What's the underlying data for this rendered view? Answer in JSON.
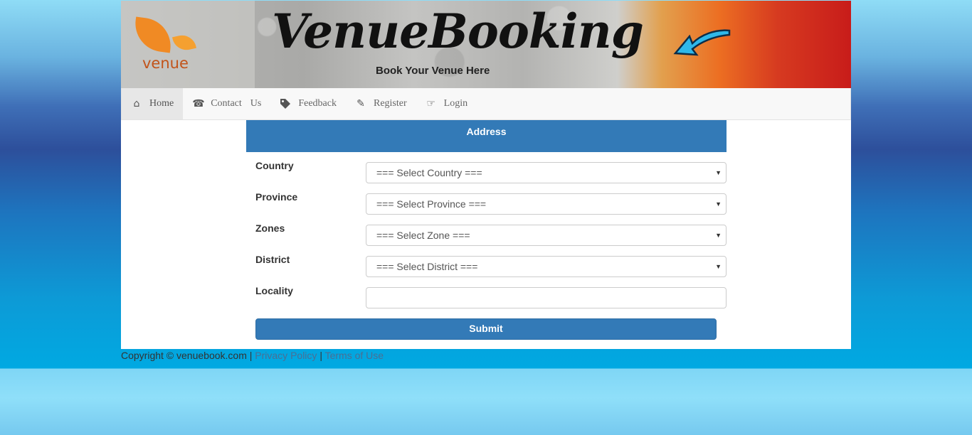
{
  "header": {
    "logo_text": "venue",
    "title": "VenueBooking",
    "tagline": "Book Your Venue Here"
  },
  "nav": {
    "items": [
      {
        "label": "Home",
        "icon": "home-icon",
        "active": true
      },
      {
        "label": "Contact",
        "label2": "Us",
        "icon": "phone-icon"
      },
      {
        "label": "Feedback",
        "icon": "tags-icon"
      },
      {
        "label": "Register",
        "icon": "pencil-icon"
      },
      {
        "label": "Login",
        "icon": "hand-right-icon"
      }
    ]
  },
  "form": {
    "panel_title": "Address",
    "fields": [
      {
        "label": "Country",
        "value": "=== Select Country ==="
      },
      {
        "label": "Province",
        "value": "=== Select Province ==="
      },
      {
        "label": "Zones",
        "value": "=== Select Zone ==="
      },
      {
        "label": "District",
        "value": "=== Select District ==="
      },
      {
        "label": "Locality",
        "value": ""
      }
    ],
    "submit_label": "Submit"
  },
  "footer": {
    "copyright": "Copyright © venuebook.com",
    "separator": "|",
    "privacy": "Privacy Policy",
    "terms": "Terms of Use"
  },
  "colors": {
    "primary": "#337ab7",
    "navbar_bg": "#f8f8f8"
  }
}
